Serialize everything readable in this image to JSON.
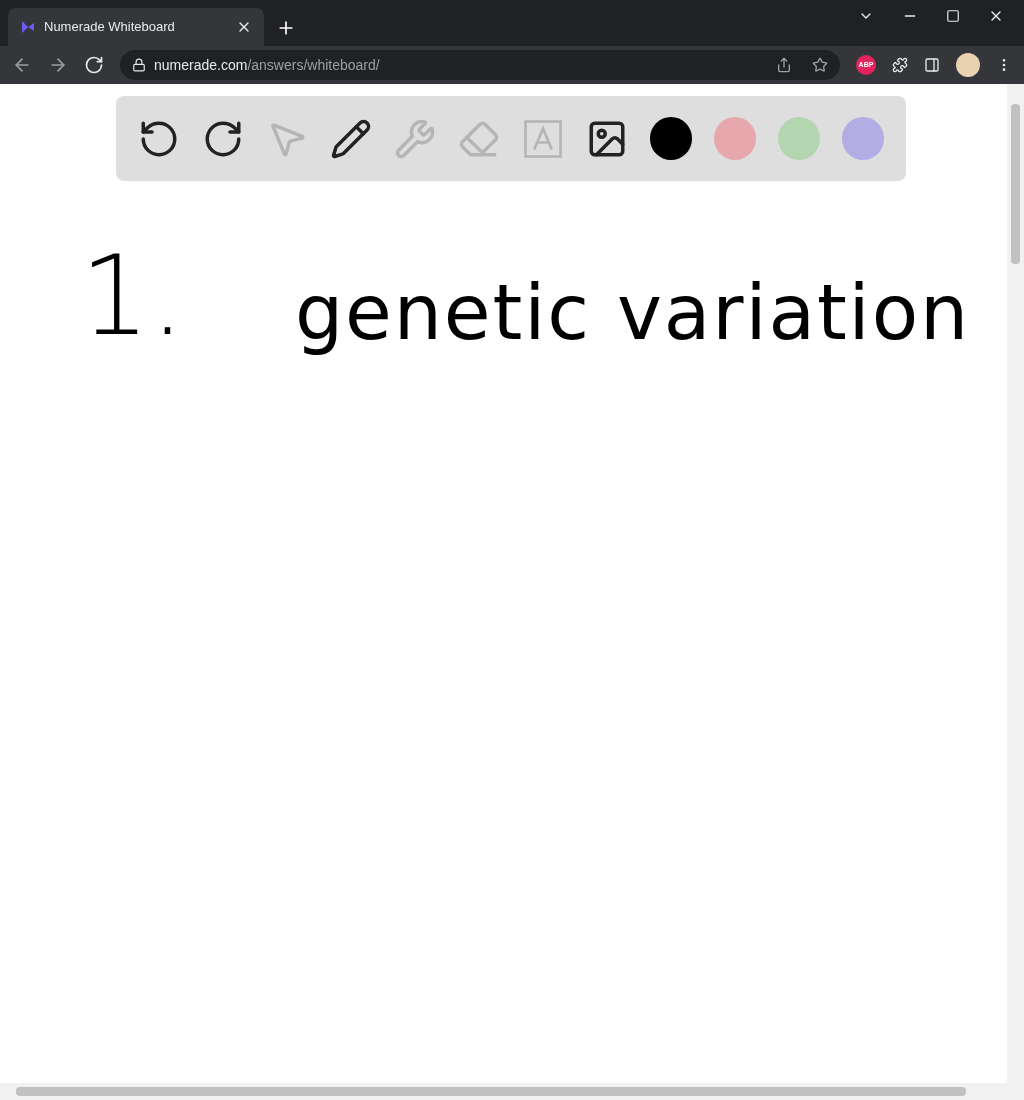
{
  "browser": {
    "tab_title": "Numerade Whiteboard",
    "url_domain": "numerade.com",
    "url_path": "/answers/whiteboard/",
    "extension_badge": "ABP"
  },
  "toolbar": {
    "tools": [
      {
        "kind": "undo",
        "disabled": false
      },
      {
        "kind": "redo",
        "disabled": false
      },
      {
        "kind": "select",
        "disabled": true
      },
      {
        "kind": "pen",
        "disabled": false
      },
      {
        "kind": "tools",
        "disabled": true
      },
      {
        "kind": "eraser",
        "disabled": true
      },
      {
        "kind": "text",
        "disabled": true
      },
      {
        "kind": "image",
        "disabled": false
      }
    ],
    "colors": [
      {
        "color": "#000000"
      },
      {
        "color": "#e6a8ad"
      },
      {
        "color": "#b3d6b0"
      },
      {
        "color": "#b3ade6"
      }
    ]
  },
  "canvas": {
    "number": "1.",
    "phrase": "genetic variation"
  }
}
